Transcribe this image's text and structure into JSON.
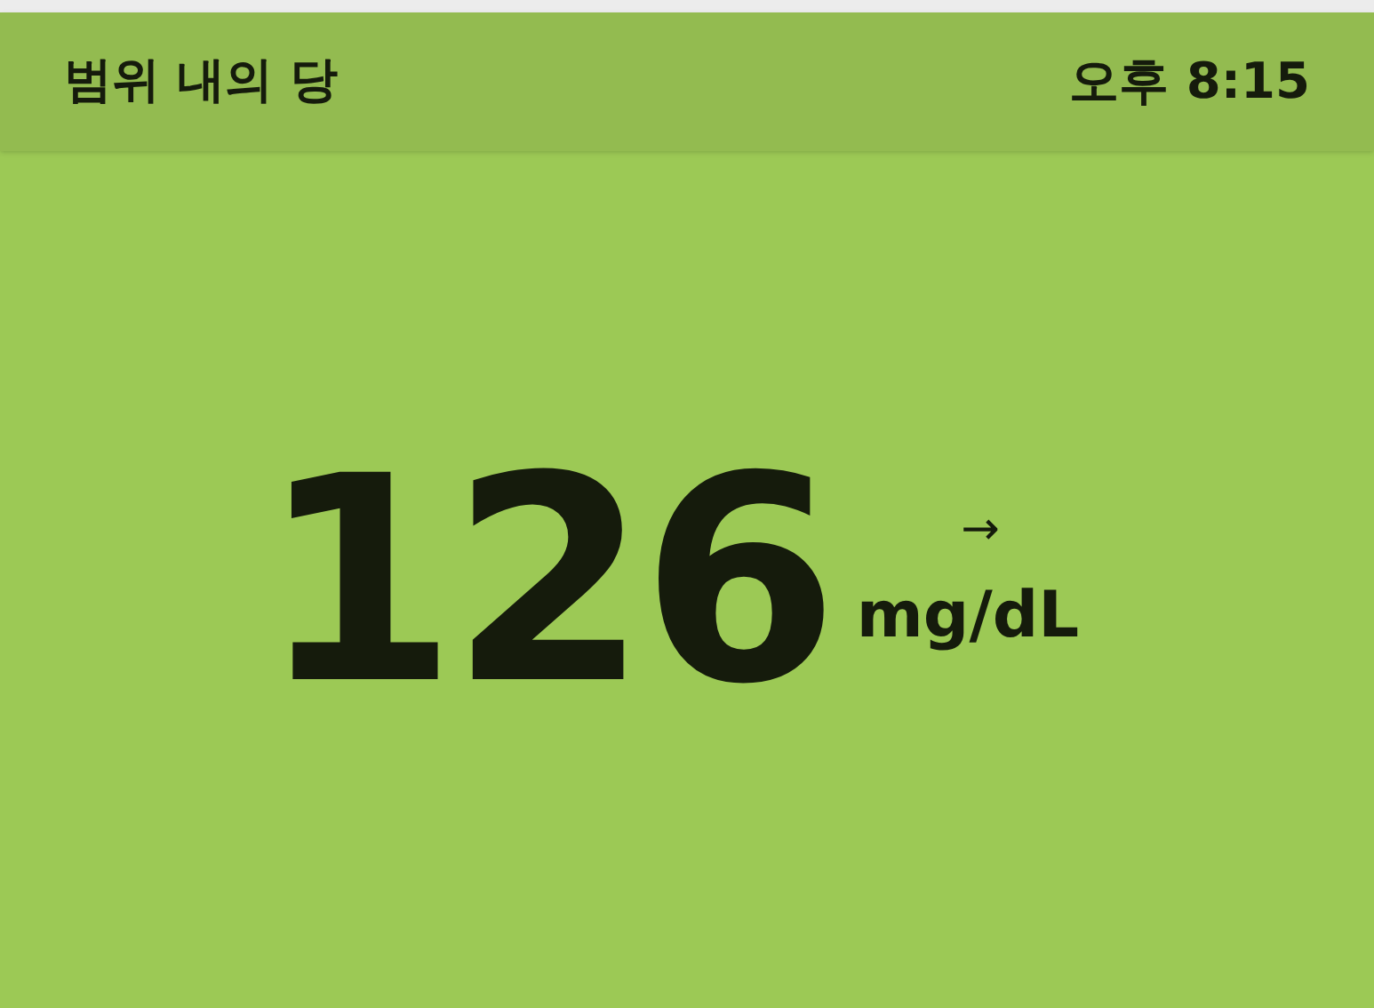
{
  "header": {
    "title": "범위 내의 당",
    "time": "오후 8:15"
  },
  "reading": {
    "value": "126",
    "trend": "→",
    "unit": "mg/dL"
  }
}
